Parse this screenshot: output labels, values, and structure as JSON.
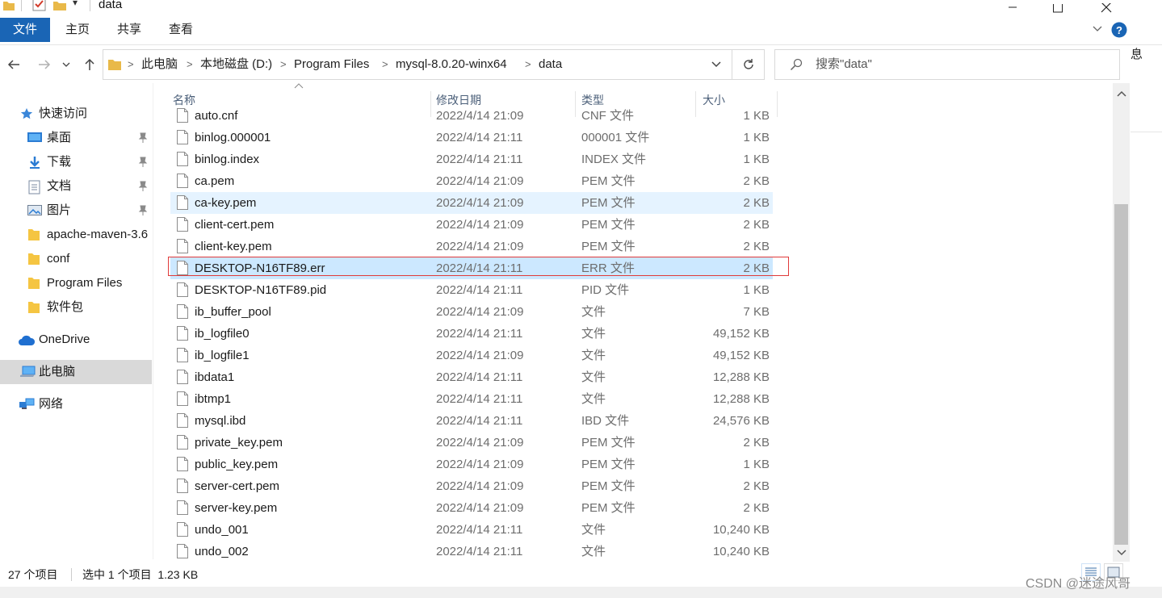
{
  "window": {
    "title": "data"
  },
  "ribbon": {
    "tabs": [
      "文件",
      "主页",
      "共享",
      "查看"
    ]
  },
  "address": {
    "crumbs": [
      "此电脑",
      "本地磁盘 (D:)",
      "Program Files",
      "mysql-8.0.20-winx64",
      "data"
    ]
  },
  "search": {
    "placeholder": "搜索\"data\""
  },
  "nav": {
    "quick_access": "快速访问",
    "items": [
      {
        "label": "桌面",
        "icon": "desktop-icon",
        "pinned": true
      },
      {
        "label": "下载",
        "icon": "download-icon",
        "pinned": true
      },
      {
        "label": "文档",
        "icon": "document-icon",
        "pinned": true
      },
      {
        "label": "图片",
        "icon": "pictures-icon",
        "pinned": true
      },
      {
        "label": "apache-maven-3.6",
        "icon": "folder-icon",
        "pinned": false
      },
      {
        "label": "conf",
        "icon": "folder-icon",
        "pinned": false
      },
      {
        "label": "Program Files",
        "icon": "folder-icon",
        "pinned": false
      },
      {
        "label": "软件包",
        "icon": "folder-icon",
        "pinned": false
      }
    ],
    "onedrive": "OneDrive",
    "this_pc": "此电脑",
    "network": "网络"
  },
  "columns": {
    "name": "名称",
    "date": "修改日期",
    "type": "类型",
    "size": "大小"
  },
  "files": [
    {
      "name": "auto.cnf",
      "date": "2022/4/14 21:09",
      "type": "CNF 文件",
      "size": "1 KB"
    },
    {
      "name": "binlog.000001",
      "date": "2022/4/14 21:11",
      "type": "000001 文件",
      "size": "1 KB"
    },
    {
      "name": "binlog.index",
      "date": "2022/4/14 21:11",
      "type": "INDEX 文件",
      "size": "1 KB"
    },
    {
      "name": "ca.pem",
      "date": "2022/4/14 21:09",
      "type": "PEM 文件",
      "size": "2 KB"
    },
    {
      "name": "ca-key.pem",
      "date": "2022/4/14 21:09",
      "type": "PEM 文件",
      "size": "2 KB"
    },
    {
      "name": "client-cert.pem",
      "date": "2022/4/14 21:09",
      "type": "PEM 文件",
      "size": "2 KB"
    },
    {
      "name": "client-key.pem",
      "date": "2022/4/14 21:09",
      "type": "PEM 文件",
      "size": "2 KB"
    },
    {
      "name": "DESKTOP-N16TF89.err",
      "date": "2022/4/14 21:11",
      "type": "ERR 文件",
      "size": "2 KB"
    },
    {
      "name": "DESKTOP-N16TF89.pid",
      "date": "2022/4/14 21:11",
      "type": "PID 文件",
      "size": "1 KB"
    },
    {
      "name": "ib_buffer_pool",
      "date": "2022/4/14 21:09",
      "type": "文件",
      "size": "7 KB"
    },
    {
      "name": "ib_logfile0",
      "date": "2022/4/14 21:11",
      "type": "文件",
      "size": "49,152 KB"
    },
    {
      "name": "ib_logfile1",
      "date": "2022/4/14 21:09",
      "type": "文件",
      "size": "49,152 KB"
    },
    {
      "name": "ibdata1",
      "date": "2022/4/14 21:11",
      "type": "文件",
      "size": "12,288 KB"
    },
    {
      "name": "ibtmp1",
      "date": "2022/4/14 21:11",
      "type": "文件",
      "size": "12,288 KB"
    },
    {
      "name": "mysql.ibd",
      "date": "2022/4/14 21:11",
      "type": "IBD 文件",
      "size": "24,576 KB"
    },
    {
      "name": "private_key.pem",
      "date": "2022/4/14 21:09",
      "type": "PEM 文件",
      "size": "2 KB"
    },
    {
      "name": "public_key.pem",
      "date": "2022/4/14 21:09",
      "type": "PEM 文件",
      "size": "1 KB"
    },
    {
      "name": "server-cert.pem",
      "date": "2022/4/14 21:09",
      "type": "PEM 文件",
      "size": "2 KB"
    },
    {
      "name": "server-key.pem",
      "date": "2022/4/14 21:09",
      "type": "PEM 文件",
      "size": "2 KB"
    },
    {
      "name": "undo_001",
      "date": "2022/4/14 21:11",
      "type": "文件",
      "size": "10,240 KB"
    },
    {
      "name": "undo_002",
      "date": "2022/4/14 21:11",
      "type": "文件",
      "size": "10,240 KB"
    }
  ],
  "selected_file": "DESKTOP-N16TF89.err",
  "hovered_file": "ca-key.pem",
  "status": {
    "count": "27 个项目",
    "selection": "选中 1 个项目  1.23 KB"
  },
  "clipped_right_text": "息",
  "watermark": "CSDN @迷途风哥",
  "colors": {
    "accent": "#1a65b5",
    "selected_row": "#cce8ff",
    "hover_row": "#e5f3ff",
    "highlight_border": "#e03a3a",
    "folder": "#f5c542"
  }
}
